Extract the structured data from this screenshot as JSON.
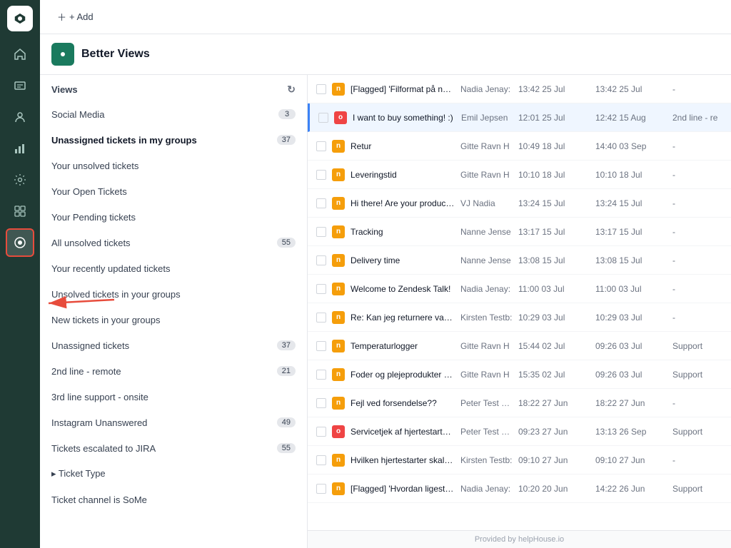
{
  "topbar": {
    "add_label": "+ Add"
  },
  "app": {
    "icon": "🟢",
    "title": "Better Views"
  },
  "sidebar": {
    "views_label": "Views",
    "items": [
      {
        "id": "social-media",
        "label": "Social Media",
        "badge": "3",
        "active": false,
        "bold": false
      },
      {
        "id": "unassigned-in-groups",
        "label": "Unassigned tickets in my groups",
        "badge": "37",
        "active": false,
        "bold": true
      },
      {
        "id": "your-unsolved",
        "label": "Your unsolved tickets",
        "badge": null,
        "active": false,
        "bold": false
      },
      {
        "id": "your-open",
        "label": "Your Open Tickets",
        "badge": null,
        "active": false,
        "bold": false
      },
      {
        "id": "your-pending",
        "label": "Your Pending tickets",
        "badge": null,
        "active": false,
        "bold": false
      },
      {
        "id": "all-unsolved",
        "label": "All unsolved tickets",
        "badge": "55",
        "active": false,
        "bold": false
      },
      {
        "id": "your-recently-updated",
        "label": "Your recently updated tickets",
        "badge": null,
        "active": false,
        "bold": false
      },
      {
        "id": "unsolved-in-groups",
        "label": "Unsolved tickets in your groups",
        "badge": null,
        "active": false,
        "bold": false
      },
      {
        "id": "new-in-groups",
        "label": "New tickets in your groups",
        "badge": null,
        "active": false,
        "bold": false
      },
      {
        "id": "unassigned",
        "label": "Unassigned tickets",
        "badge": "37",
        "active": false,
        "bold": false
      },
      {
        "id": "2nd-line-remote",
        "label": "2nd line - remote",
        "badge": "21",
        "active": false,
        "bold": false
      },
      {
        "id": "3rd-line-onsite",
        "label": "3rd line support - onsite",
        "badge": null,
        "active": false,
        "bold": false
      },
      {
        "id": "instagram",
        "label": "Instagram Unanswered",
        "badge": "49",
        "active": false,
        "bold": false
      },
      {
        "id": "jira",
        "label": "Tickets escalated to JIRA",
        "badge": "55",
        "active": false,
        "bold": false
      },
      {
        "id": "ticket-type",
        "label": "▸ Ticket Type",
        "badge": null,
        "active": false,
        "bold": false
      },
      {
        "id": "ticket-channel",
        "label": "Ticket channel is SoMe",
        "badge": null,
        "active": false,
        "bold": false
      }
    ]
  },
  "tickets": [
    {
      "id": 1,
      "priority": "normal",
      "subject": "[Flagged] 'Filformat på nemEDI",
      "requester": "Nadia Jenay:",
      "created": "13:42 25 Jul",
      "updated": "13:42 25 Jul",
      "group": "-",
      "selected": false
    },
    {
      "id": 2,
      "priority": "urgent",
      "subject": "I want to buy something! :)",
      "requester": "Emil Jepsen",
      "created": "12:01 25 Jul",
      "updated": "12:42 15 Aug",
      "group": "2nd line - re",
      "selected": true
    },
    {
      "id": 3,
      "priority": "normal",
      "subject": "Retur",
      "requester": "Gitte Ravn H",
      "created": "10:49 18 Jul",
      "updated": "14:40 03 Sep",
      "group": "-",
      "selected": false
    },
    {
      "id": 4,
      "priority": "normal",
      "subject": "Leveringstid",
      "requester": "Gitte Ravn H",
      "created": "10:10 18 Jul",
      "updated": "10:10 18 Jul",
      "group": "-",
      "selected": false
    },
    {
      "id": 5,
      "priority": "normal",
      "subject": "Hi there! Are your products org",
      "requester": "VJ Nadia",
      "created": "13:24 15 Jul",
      "updated": "13:24 15 Jul",
      "group": "-",
      "selected": false
    },
    {
      "id": 6,
      "priority": "normal",
      "subject": "Tracking",
      "requester": "Nanne Jense",
      "created": "13:17 15 Jul",
      "updated": "13:17 15 Jul",
      "group": "-",
      "selected": false
    },
    {
      "id": 7,
      "priority": "normal",
      "subject": "Delivery time",
      "requester": "Nanne Jense",
      "created": "13:08 15 Jul",
      "updated": "13:08 15 Jul",
      "group": "-",
      "selected": false
    },
    {
      "id": 8,
      "priority": "normal",
      "subject": "Welcome to Zendesk Talk!",
      "requester": "Nadia Jenay:",
      "created": "11:00 03 Jul",
      "updated": "11:00 03 Jul",
      "group": "-",
      "selected": false
    },
    {
      "id": 9,
      "priority": "normal",
      "subject": "Re: Kan jeg returnere vare købt",
      "requester": "Kirsten Testb:",
      "created": "10:29 03 Jul",
      "updated": "10:29 03 Jul",
      "group": "-",
      "selected": false
    },
    {
      "id": 10,
      "priority": "normal",
      "subject": "Temperaturlogger",
      "requester": "Gitte Ravn H",
      "created": "15:44 02 Jul",
      "updated": "09:26 03 Jul",
      "group": "Support",
      "selected": false
    },
    {
      "id": 11,
      "priority": "normal",
      "subject": "Foder og plejeprodukter til mir",
      "requester": "Gitte Ravn H",
      "created": "15:35 02 Jul",
      "updated": "09:26 03 Jul",
      "group": "Support",
      "selected": false
    },
    {
      "id": 12,
      "priority": "normal",
      "subject": "Fejl ved forsendelse??",
      "requester": "Peter Test Ha:",
      "created": "18:22 27 Jun",
      "updated": "18:22 27 Jun",
      "group": "-",
      "selected": false
    },
    {
      "id": 13,
      "priority": "urgent",
      "subject": "Servicetjek af hjertestarter?",
      "requester": "Peter Test Ha:",
      "created": "09:23 27 Jun",
      "updated": "13:13 26 Sep",
      "group": "Support",
      "selected": false
    },
    {
      "id": 14,
      "priority": "normal",
      "subject": "Hvilken hjertestarter skal jeg va",
      "requester": "Kirsten Testb:",
      "created": "09:10 27 Jun",
      "updated": "09:10 27 Jun",
      "group": "-",
      "selected": false
    },
    {
      "id": 15,
      "priority": "normal",
      "subject": "[Flagged] 'Hvordan ligestiller I j",
      "requester": "Nadia Jenay:",
      "created": "10:20 20 Jun",
      "updated": "14:22 26 Jun",
      "group": "Support",
      "selected": false
    }
  ],
  "footer": {
    "label": "Provided by helpHouse.io"
  },
  "nav": {
    "icons": [
      {
        "id": "home",
        "symbol": "⌂",
        "active": false
      },
      {
        "id": "tickets",
        "symbol": "☰",
        "active": false
      },
      {
        "id": "users",
        "symbol": "👤",
        "active": false
      },
      {
        "id": "reports",
        "symbol": "📊",
        "active": false
      },
      {
        "id": "settings",
        "symbol": "⚙",
        "active": false
      },
      {
        "id": "apps",
        "symbol": "⧉",
        "active": false
      },
      {
        "id": "better-views",
        "symbol": "◉",
        "active": true,
        "highlighted": true
      }
    ]
  }
}
